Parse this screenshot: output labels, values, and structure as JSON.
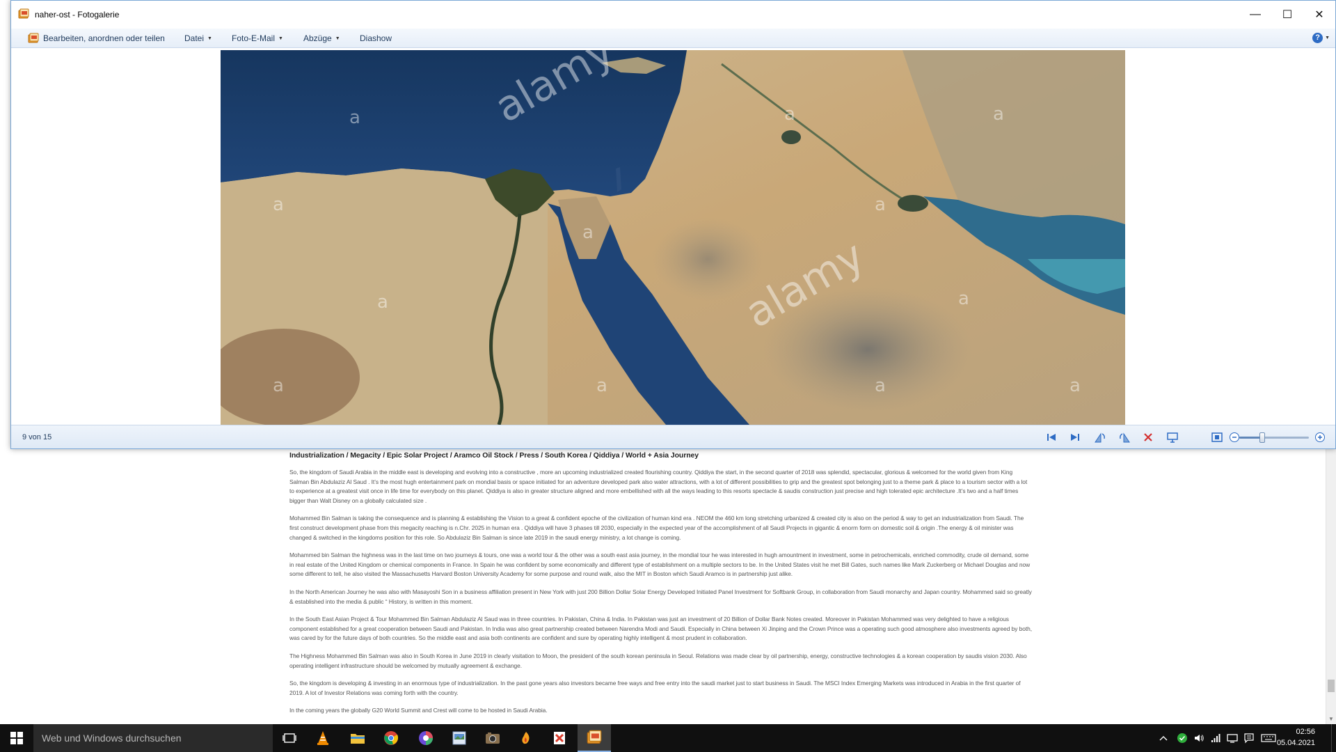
{
  "window": {
    "title": "naher-ost - Fotogalerie",
    "minimize_glyph": "—",
    "maximize_glyph": "☐",
    "close_glyph": "✕"
  },
  "toolbar": {
    "edit_label": "Bearbeiten, anordnen oder teilen",
    "file_label": "Datei",
    "email_label": "Foto-E-Mail",
    "prints_label": "Abzüge",
    "slideshow_label": "Diashow",
    "help_glyph": "?"
  },
  "photo": {
    "watermark_brand": "alamy",
    "watermark_letter": "a"
  },
  "statusbar": {
    "counter": "9 von 15",
    "zoom_fraction": 0.33
  },
  "article": {
    "title": "Industrialization / Megacity  /  Epic Solar Project / Aramco Oil Stock / Press / South Korea / Qiddiya / World +  Asia Journey",
    "paragraphs": [
      "So, the kingdom of Saudi Arabia in the middle east is developing and evolving into a constructive , more an upcoming industrialized created flourishing country. Qiddiya the start, in the second quarter of 2018 was splendid, spectacular, glorious  & welcomed for the world given from King Salman Bin Abdulaziz  Al Saud . It’s the most hugh entertainment park on mondial basis or space initiated for an adventure developed park also water attractions, with a lot of different possibilities to grip and the greatest spot belonging just to a theme park & place to a tourism sector with a lot to experience at a greatest visit once  in life time for everybody on this planet. Qiddiya is  also in greater structure aligned and more embellished with all the ways leading to this resorts spectacle & saudis construction just  precise and high tolerated  epic architecture  .It’s two  and a half times bigger than Walt Disney on a globally calculated size .",
      "Mohammed Bin Salman is taking the consequence and is planning & establishing the Vision to a great & confident epoche of the civilization of human kind era . NEOM the 460 km long stretching urbanized & created city is also on the period & way to get an industrialization from Saudi. The first construct development phase from this megacity reaching is n.Chr. 2025 in human era . Qiddiya will have 3 phases till 2030, especially in the expected year of the accomplishment of all Saudi Projects in gigantic & enorm  form on domestic soil & origin .The energy & oil minister was changed & switched in the kingdoms position for this role. So Abdulaziz Bin Salman is since late 2019 in the saudi energy ministry, a lot change is coming.",
      "Mohammed bin Salman the highness  was in the last time  on two journeys & tours, one was a world tour & the other was a south east asia journey, in the mondial tour  he was interested in hugh amountment in investment, some in petrochemicals, enriched commodity, crude oil demand, some in real estate of the United Kingdom or chemical components in France. In Spain he was confident by some economically and different type of establishment on a multiple sectors to be. In the United States visit he met Bill Gates, such names like Mark  Zuckerberg or Michael Douglas and now some different to tell, he also visited the Massachusetts Harvard Boston University Academy for some purpose and round walk, also the MIT in Boston which Saudi Aramco is in partnership just alike.",
      "In the North American Journey he was also with Masayoshi Son in a business affiliation present in New York  with just 200 Billion Dollar Solar Energy Developed Initiated  Panel Investment for Softbank Group, in collaboration from Saudi monarchy and Japan country. Mohammed said so greatly & established into the media & public “ History, is written in this moment.",
      "In the South East Asian Project & Tour Mohammed Bin Salman Abdulaziz Al Saud was in three countries. In Pakistan, China & India. In Pakistan was just an investment of 20 Billion of Dollar Bank Notes created. Moreover in Pakistan Mohammed was very delighted to have a religious component established for a great cooperation between Saudi and Pakistan. In India was also great partnership created between Narendra Modi and Saudi. Especially in China between Xi Jinping  and the Crown Prince was a operating such good atmosphere also investments agreed by both, was cared by for the future days of both countries. So the middle east and asia both continents are confident and sure by operating highly intelligent & most prudent in collaboration.",
      "The Highness Mohammed Bin Salman was also in South Korea in June 2019 in clearly visitation to Moon,  the president of the south korean peninsula in Seoul. Relations was made clear by oil partnership, energy, constructive technologies  & a korean cooperation by saudis vision 2030. Also operating intelligent infrastructure should be welcomed by mutually agreement & exchange.",
      "So, the kingdom is developing & investing in an enormous type of industrialization. In the past gone years also investors became free ways and free entry into the saudi market just to start business in Saudi. The MSCI Index Emerging Markets was introduced in Arabia in the first quarter of 2019. A lot of Investor Relations was coming forth with the country.",
      "In the coming years the globally G20 World Summit and Crest will come to be hosted in Saudi Arabia."
    ]
  },
  "taskbar": {
    "search_placeholder": "Web und Windows durchsuchen",
    "time": "02:56",
    "date": "05.04.2021"
  },
  "colors": {
    "accent": "#2d6bc4",
    "toolbar_text": "#1e395b",
    "taskbar": "#101010"
  },
  "icons": {
    "start": "windows-logo-icon",
    "task_view": "task-view-icon",
    "vlc": "vlc-cone-icon",
    "explorer": "file-explorer-icon",
    "chrome": "chrome-icon"
  }
}
